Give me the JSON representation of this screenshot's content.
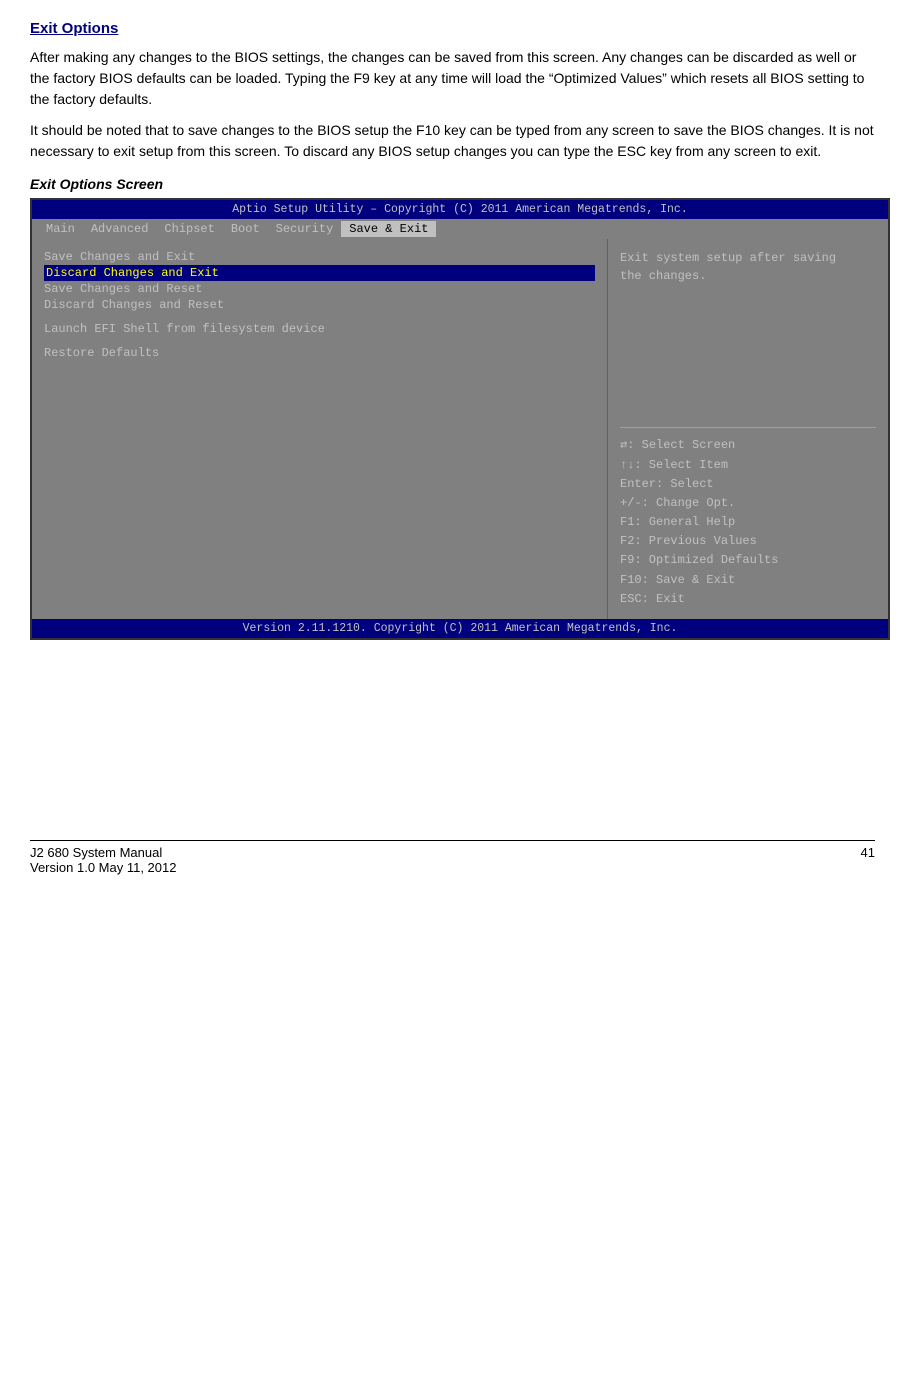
{
  "page": {
    "title": "Exit Options",
    "paragraphs": [
      "After making any changes to the BIOS settings, the changes can be saved from this screen. Any changes can be discarded as well or the factory BIOS defaults can be loaded. Typing the F9 key at any time will load the “Optimized Values” which resets all BIOS setting to the factory defaults.",
      "It should be noted that to save changes to the BIOS setup the F10 key can be typed from any screen to save the BIOS changes. It is not necessary to exit setup from this screen. To discard any BIOS setup changes you can type the ESC key from any screen to exit."
    ],
    "screen_title": "Exit Options Screen"
  },
  "bios": {
    "header": "Aptio Setup Utility – Copyright (C) 2011 American Megatrends, Inc.",
    "nav_items": [
      "Main",
      "Advanced",
      "Chipset",
      "Boot",
      "Security",
      "Save & Exit"
    ],
    "nav_active": "Save & Exit",
    "menu_items": [
      {
        "label": "Save Changes and Exit",
        "selected": false
      },
      {
        "label": "Discard Changes and Exit",
        "selected": true
      },
      {
        "label": "Save Changes and Reset",
        "selected": false
      },
      {
        "label": "Discard Changes and Reset",
        "selected": false
      },
      {
        "label": "",
        "spacer": true
      },
      {
        "label": "Launch EFI Shell from filesystem device",
        "selected": false
      },
      {
        "label": "",
        "spacer": true
      },
      {
        "label": "Restore Defaults",
        "selected": false
      }
    ],
    "right_desc": "Exit system setup after saving\nthe changes.",
    "right_keys": [
      "↔: Select Screen",
      "↑↓: Select Item",
      "Enter: Select",
      "+/-: Change Opt.",
      "F1: General Help",
      "F2: Previous Values",
      "F9: Optimized Defaults",
      "F10: Save & Exit",
      "ESC: Exit"
    ],
    "footer": "Version 2.11.1210. Copyright (C) 2011 American Megatrends, Inc."
  },
  "page_footer": {
    "left": "J2 680 System Manual\nVersion 1.0 May 11, 2012",
    "right": "41"
  }
}
